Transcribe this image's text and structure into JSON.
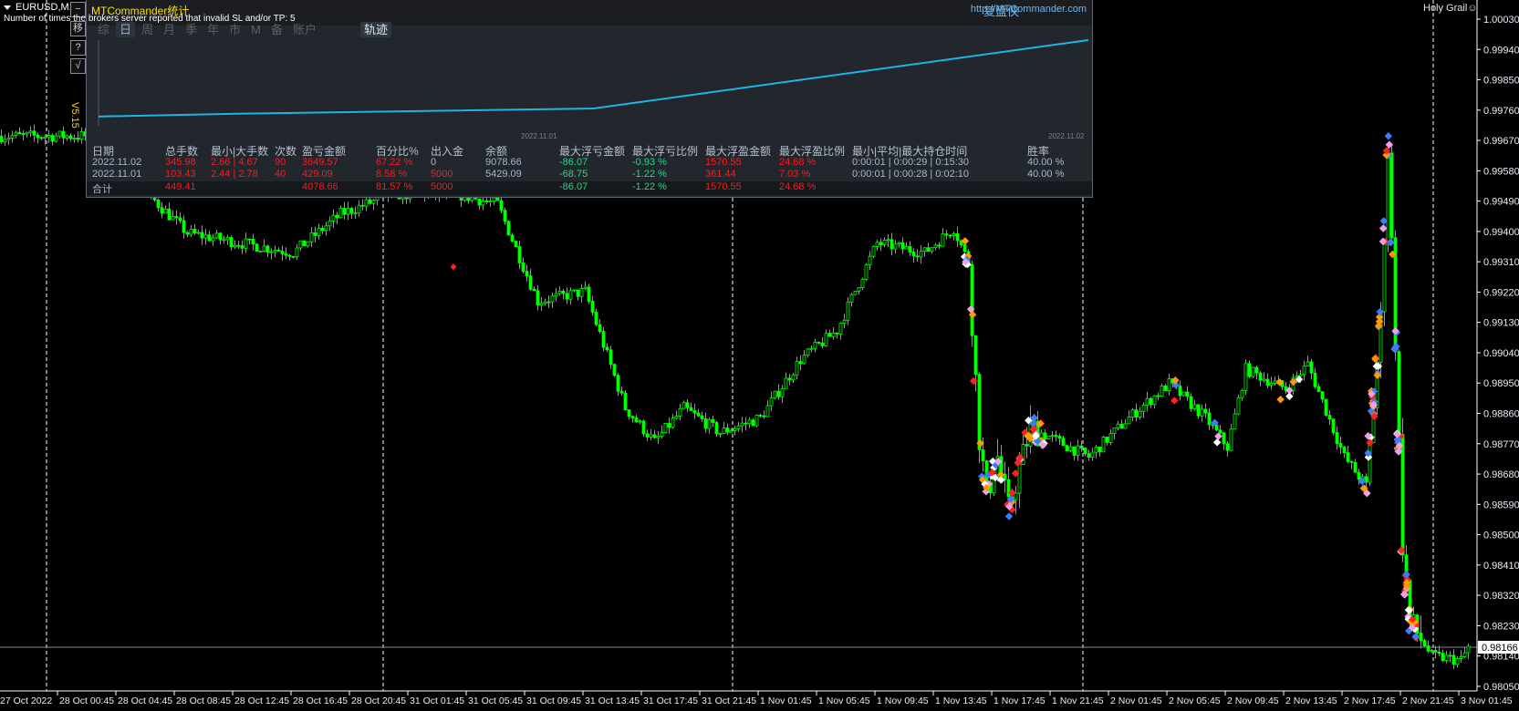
{
  "window": {
    "symbol": "EURUSD,M15",
    "notice": "Number of times the brokers server reported that invalid SL and/or TP: 5",
    "holy_grail": "Holy Grail☺",
    "version": "V5.15"
  },
  "side_buttons": [
    "−",
    "移",
    "?",
    "√"
  ],
  "panel": {
    "title": "MTCommander统计",
    "brand": "复盘侠",
    "url": "http://MTCommander.com",
    "tabs": [
      "综",
      "日",
      "周",
      "月",
      "季",
      "年",
      "市",
      "M",
      "备",
      "账户"
    ],
    "active_tab": "日",
    "track_tab": "轨迹",
    "graph_labels": [
      "2022.11.01",
      "2022.11.02"
    ],
    "columns": [
      "日期",
      "总手数",
      "最小|大手数",
      "次数",
      "盈亏金额",
      "百分比%",
      "出入金",
      "余额",
      "最大浮亏金额",
      "最大浮亏比例",
      "最大浮盈金额",
      "最大浮盈比例",
      "最小|平均|最大持仓时间",
      "胜率"
    ],
    "rows": [
      [
        "2022.11.02",
        "345.98",
        "2.66 | 4.67",
        "90",
        "3649.57",
        "67.22 %",
        "0",
        "9078.66",
        "-86.07",
        "-0.93 %",
        "1570.55",
        "24.68 %",
        "0:00:01 | 0:00:29 | 0:15:30",
        "40.00 %"
      ],
      [
        "2022.11.01",
        "103.43",
        "2.44 | 2.78",
        "40",
        "429.09",
        "8.58 %",
        "5000",
        "5429.09",
        "-68.75",
        "-1.22 %",
        "361.44",
        "7.03 %",
        "0:00:01 | 0:00:28 | 0:02:10",
        "40.00 %"
      ]
    ],
    "total": [
      "合计",
      "449.41",
      "",
      "",
      "4078.66",
      "81.57 %",
      "5000",
      "",
      "-86.07",
      "-1.22 %",
      "1570.55",
      "24.68 %",
      "",
      ""
    ],
    "equity_curve": [
      [
        0,
        5000
      ],
      [
        0.5,
        5429.09
      ],
      [
        1,
        9078.66
      ]
    ],
    "curve_color": "#1ab6ea"
  },
  "chart_data": {
    "type": "candlestick",
    "symbol": "EURUSD",
    "timeframe": "M15",
    "price_ticks": [
      "1.00030",
      "0.99940",
      "0.99850",
      "0.99760",
      "0.99670",
      "0.99580",
      "0.99490",
      "0.99400",
      "0.99310",
      "0.99220",
      "0.99130",
      "0.99040",
      "0.98950",
      "0.98860",
      "0.98770",
      "0.98680",
      "0.98590",
      "0.98500",
      "0.98410",
      "0.98320",
      "0.98230",
      "0.98140",
      "0.98050"
    ],
    "ylim": [
      0.9805,
      1.0003
    ],
    "current_price": "0.98166",
    "time_labels": [
      "27 Oct 2022",
      "28 Oct 00:45",
      "28 Oct 04:45",
      "28 Oct 08:45",
      "28 Oct 12:45",
      "28 Oct 16:45",
      "28 Oct 20:45",
      "31 Oct 01:45",
      "31 Oct 05:45",
      "31 Oct 09:45",
      "31 Oct 13:45",
      "31 Oct 17:45",
      "31 Oct 21:45",
      "1 Nov 01:45",
      "1 Nov 05:45",
      "1 Nov 09:45",
      "1 Nov 13:45",
      "1 Nov 17:45",
      "1 Nov 21:45",
      "2 Nov 01:45",
      "2 Nov 05:45",
      "2 Nov 09:45",
      "2 Nov 13:45",
      "2 Nov 17:45",
      "2 Nov 21:45",
      "3 Nov 01:45"
    ],
    "price_path": [
      [
        0,
        0.99683
      ],
      [
        24,
        0.99683
      ],
      [
        51,
        0.99395
      ],
      [
        80,
        0.99337
      ],
      [
        93,
        0.99452
      ],
      [
        107,
        0.9951
      ],
      [
        125,
        0.9951
      ],
      [
        136,
        0.99481
      ],
      [
        147,
        0.99193
      ],
      [
        160,
        0.99222
      ],
      [
        171,
        0.98876
      ],
      [
        179,
        0.98775
      ],
      [
        187,
        0.98876
      ],
      [
        197,
        0.98803
      ],
      [
        208,
        0.98847
      ],
      [
        219,
        0.9902
      ],
      [
        229,
        0.99106
      ],
      [
        240,
        0.99366
      ],
      [
        253,
        0.99337
      ],
      [
        261,
        0.99409
      ],
      [
        265,
        0.99308
      ],
      [
        268,
        0.98789
      ],
      [
        270,
        0.98616
      ],
      [
        273,
        0.98731
      ],
      [
        276,
        0.98573
      ],
      [
        282,
        0.98818
      ],
      [
        298,
        0.98731
      ],
      [
        309,
        0.98847
      ],
      [
        320,
        0.98948
      ],
      [
        330,
        0.98847
      ],
      [
        336,
        0.9876
      ],
      [
        341,
        0.98991
      ],
      [
        352,
        0.98933
      ],
      [
        358,
        0.99006
      ],
      [
        368,
        0.98731
      ],
      [
        374,
        0.98645
      ],
      [
        378,
        0.99135
      ],
      [
        380,
        0.99654
      ],
      [
        382,
        0.99077
      ],
      [
        384,
        0.98472
      ],
      [
        386,
        0.98242
      ],
      [
        392,
        0.9814
      ],
      [
        400,
        0.98127
      ],
      [
        402,
        0.98166
      ]
    ],
    "colors": {
      "candle": "#00ff00",
      "current_price_line": "#7d8aa0",
      "separator": "#ffffff"
    }
  }
}
